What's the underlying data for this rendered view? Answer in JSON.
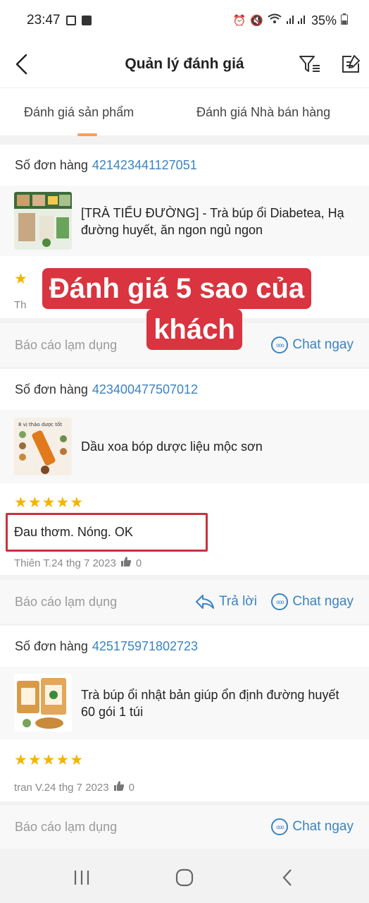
{
  "status_bar": {
    "time": "23:47",
    "battery": "35%"
  },
  "header": {
    "title": "Quản lý đánh giá"
  },
  "tabs": [
    {
      "label": "Đánh giá sản phẩm",
      "active": true
    },
    {
      "label": "Đánh giá Nhà bán hàng",
      "active": false
    }
  ],
  "orders": [
    {
      "order_label": "Số đơn hàng",
      "order_number": "421423441127051",
      "product_name": "[TRÀ TIỂU ĐƯỜNG] - Trà búp ổi Diabetea, Hạ đường huyết, ăn ngon ngủ ngon",
      "reviewer_date": "Th",
      "report_label": "Báo cáo lạm dụng",
      "chat_label": "Chat ngay"
    },
    {
      "order_label": "Số đơn hàng",
      "order_number": "423400477507012",
      "product_name": "Dầu xoa bóp dược liệu mộc sơn",
      "thumb_text": "8 vị thảo dược tốt",
      "rating": 5,
      "comment": "Đau thơm. Nóng. OK",
      "reviewer_date": "Thiên T.24 thg 7 2023",
      "likes": "0",
      "report_label": "Báo cáo lạm dụng",
      "reply_label": "Trả lời",
      "chat_label": "Chat ngay"
    },
    {
      "order_label": "Số đơn hàng",
      "order_number": "425175971802723",
      "product_name": "Trà búp ổi nhật bản giúp ổn định đường huyết 60 gói 1 túi",
      "rating": 5,
      "reviewer_date": "tran V.24 thg 7 2023",
      "likes": "0",
      "report_label": "Báo cáo lạm dụng",
      "chat_label": "Chat ngay"
    }
  ],
  "overlay": {
    "line1": "Đánh giá 5 sao của",
    "line2": "khách"
  },
  "colors": {
    "accent_blue": "#3a83c4",
    "star": "#f5b400",
    "tab_indicator": "#f5a15a",
    "overlay_red": "#d9343f"
  },
  "icons": [
    "back-arrow-icon",
    "filter-icon",
    "edit-icon",
    "chat-icon",
    "reply-icon",
    "thumbs-up-icon",
    "star-icon"
  ]
}
